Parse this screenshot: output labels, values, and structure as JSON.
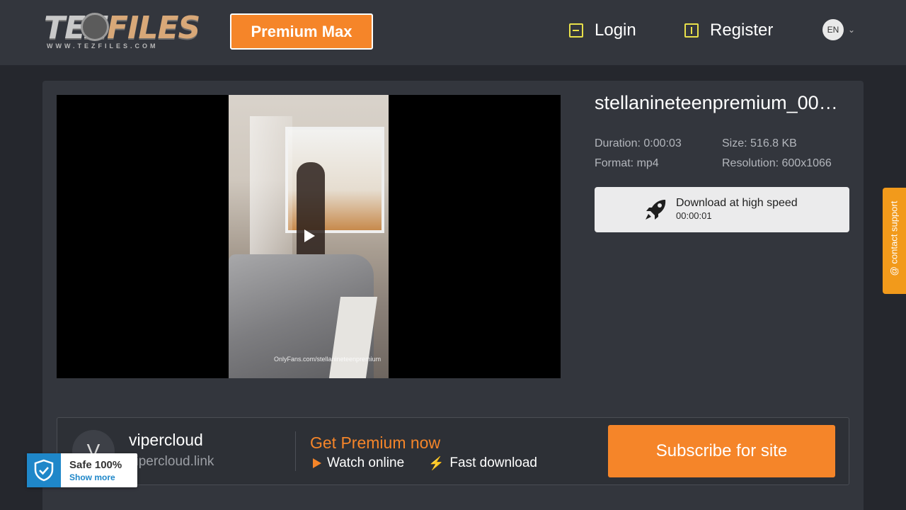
{
  "header": {
    "logo_text_main": "TEZ",
    "logo_text_accent": "FILES",
    "logo_url": "WWW.TEZFILES.COM",
    "premium_button": "Premium Max",
    "login": "Login",
    "register": "Register",
    "language": "EN",
    "icons": {
      "login": "login-arrow-icon",
      "register": "upload-arrow-icon",
      "language_caret": "chevron-down-icon"
    }
  },
  "video": {
    "watermark": "OnlyFans.com/stellanineteenpremium",
    "play_icon": "play-icon"
  },
  "file": {
    "title": "stellanineteenpremium_00…",
    "duration": "Duration: 0:00:03",
    "size": "Size: 516.8 KB",
    "format": "Format: mp4",
    "resolution": "Resolution: 600x1066"
  },
  "download": {
    "label": "Download at high speed",
    "timer": "00:00:01",
    "icon": "rocket-icon"
  },
  "support": {
    "label": "@ contact support"
  },
  "banner": {
    "avatar_letter": "V",
    "site_name": "vipercloud",
    "site_link": "vipercloud.link",
    "get_premium": "Get Premium now",
    "feature_watch": "Watch online",
    "feature_fast": "Fast download",
    "subscribe_button": "Subscribe for site"
  },
  "safe_badge": {
    "title": "Safe 100%",
    "link": "Show more"
  },
  "colors": {
    "accent_orange": "#f58529",
    "header_bg": "#33363d",
    "page_bg": "#25272d",
    "safe_blue": "#1f87c9",
    "login_icon": "#e8e04a"
  }
}
